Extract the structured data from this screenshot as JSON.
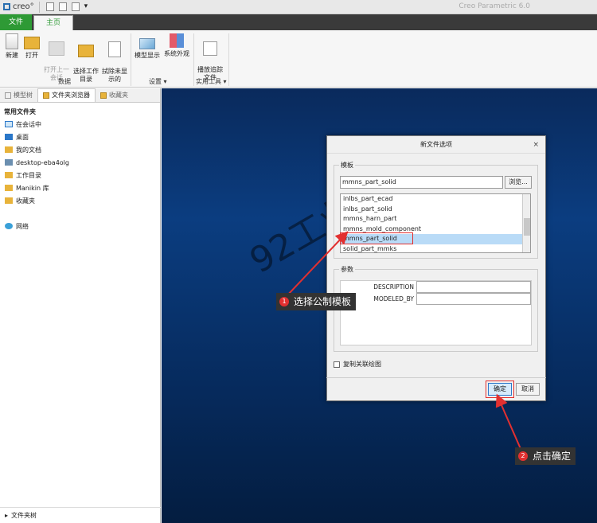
{
  "titlebar": {
    "logo": "creo°",
    "app_title": "Creo Parametric 6.0"
  },
  "tabs": {
    "file": "文件",
    "home": "主页"
  },
  "ribbon": {
    "buttons": [
      "新建",
      "打开",
      "打开上一\n会话",
      "选择工作\n目录",
      "拭除未显\n示的",
      "模型显示",
      "系统外观",
      "播放追踪\n文件"
    ],
    "groups": {
      "data": "数据",
      "settings": "设置 ▾",
      "utilities": "实用工具 ▾"
    }
  },
  "left_pane": {
    "tabs": [
      "模型树",
      "文件夹浏览器",
      "收藏夹"
    ],
    "section_title": "常用文件夹",
    "items": [
      "在会话中",
      "桌面",
      "我的文档",
      "desktop-eba4olg",
      "工作目录",
      "Manikin 库",
      "收藏夹"
    ],
    "network": "网络",
    "footer": "文件夹树"
  },
  "watermark": "92工业网",
  "dialog": {
    "title": "新文件选项",
    "close": "×",
    "template_label": "模板",
    "template_value": "mmns_part_solid",
    "browse": "浏览...",
    "template_list": [
      "inlbs_part_ecad",
      "inlbs_part_solid",
      "mmns_harn_part",
      "mmns_mold_component",
      "mmns_part_solid",
      "solid_part_mmks"
    ],
    "selected_index": 4,
    "params_label": "参数",
    "params": [
      "DESCRIPTION",
      "MODELED_BY"
    ],
    "copy_drawing": "复制关联绘图",
    "ok": "确定",
    "cancel": "取消"
  },
  "annotations": [
    {
      "num": "1",
      "text": "选择公制模板"
    },
    {
      "num": "2",
      "text": "点击确定"
    }
  ],
  "colors": {
    "accent_green": "#2e9a35",
    "annotation_red": "#e23030",
    "canvas_blue": "#0b3d80"
  }
}
